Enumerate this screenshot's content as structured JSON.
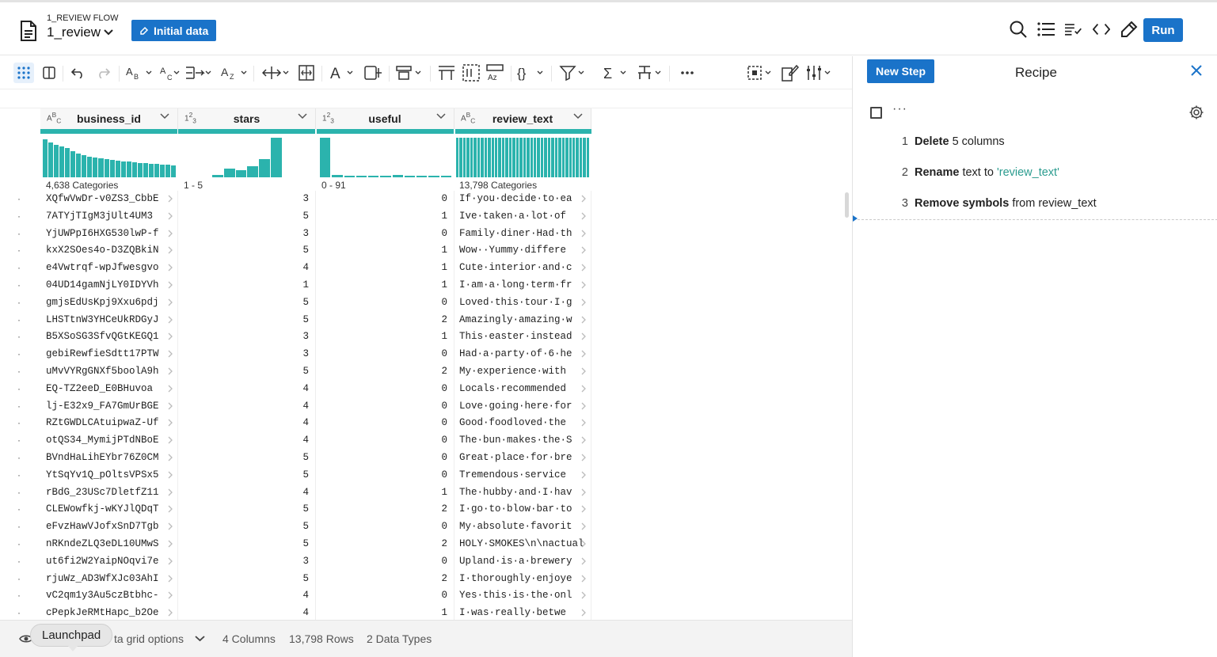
{
  "header": {
    "flow_label": "1_REVIEW FLOW",
    "flow_name": "1_review",
    "initial_data_label": "Initial data",
    "run_label": "Run"
  },
  "icons": {
    "top": [
      "search-icon",
      "list-icon",
      "list-check-icon",
      "code-icon",
      "pipette-icon"
    ],
    "toolbar": [
      "grid-view-icon",
      "columns-view-icon",
      "undo-icon",
      "redo-icon",
      "format-icon",
      "spellcheck-icon",
      "merge-icon",
      "sort-icon",
      "move-icon",
      "split-icon",
      "text-icon",
      "replace-icon",
      "structure-icon",
      "pivot-icon",
      "extract-icon",
      "text-transform-icon",
      "braces-icon",
      "filter-icon",
      "sum-icon",
      "tree-icon",
      "more-icon",
      "select-icon",
      "edit-icon",
      "settings-icon"
    ]
  },
  "columns": [
    {
      "type": "ABC",
      "name": "business_id",
      "summary": "4,638 Categories"
    },
    {
      "type": "123",
      "name": "stars",
      "summary": "1 - 5"
    },
    {
      "type": "123",
      "name": "useful",
      "summary": "0 - 91"
    },
    {
      "type": "ABC",
      "name": "review_text",
      "summary": "13,798 Categories"
    }
  ],
  "histograms": {
    "business_id": [
      0.95,
      0.88,
      0.82,
      0.78,
      0.74,
      0.66,
      0.6,
      0.55,
      0.52,
      0.5,
      0.48,
      0.46,
      0.44,
      0.42,
      0.4,
      0.39,
      0.38,
      0.36,
      0.35,
      0.34,
      0.33,
      0.32,
      0.31,
      0.3
    ],
    "stars": [
      0.06,
      0.22,
      0.18,
      0.28,
      0.45,
      1.0
    ],
    "useful": [
      1.0,
      0.05,
      0.04,
      0.04,
      0.03,
      0.02,
      0.05,
      0.02,
      0.03,
      0.02,
      0.01
    ],
    "review_text_bars": 38
  },
  "rows": [
    [
      "XQfwVwDr-v0ZS3_CbbE",
      "3",
      "0",
      "If·you·decide·to·ea"
    ],
    [
      "7ATYjTIgM3jUlt4UM3",
      "5",
      "1",
      "Ive·taken·a·lot·of"
    ],
    [
      "YjUWPpI6HXG530lwP-f",
      "3",
      "0",
      "Family·diner·Had·th"
    ],
    [
      "kxX2SOes4o-D3ZQBkiN",
      "5",
      "1",
      "Wow··Yummy·differe"
    ],
    [
      "e4Vwtrqf-wpJfwesgvo",
      "4",
      "1",
      "Cute·interior·and·c"
    ],
    [
      "04UD14gamNjLY0IDYVh",
      "1",
      "1",
      "I·am·a·long·term·fr"
    ],
    [
      "gmjsEdUsKpj9Xxu6pdj",
      "5",
      "0",
      "Loved·this·tour·I·g"
    ],
    [
      "LHSTtnW3YHCeUkRDGyJ",
      "5",
      "2",
      "Amazingly·amazing·w"
    ],
    [
      "B5XSoSG3SfvQGtKEGQ1",
      "3",
      "1",
      "This·easter·instead"
    ],
    [
      "gebiRewfieSdtt17PTW",
      "3",
      "0",
      "Had·a·party·of·6·he"
    ],
    [
      "uMvVYRgGNXf5boolA9h",
      "5",
      "2",
      "My·experience·with"
    ],
    [
      "EQ-TZ2eeD_E0BHuvoa",
      "4",
      "0",
      "Locals·recommended"
    ],
    [
      "lj-E32x9_FA7GmUrBGE",
      "4",
      "0",
      "Love·going·here·for"
    ],
    [
      "RZtGWDLCAtuipwaZ-Uf",
      "4",
      "0",
      "Good·foodloved·the"
    ],
    [
      "otQS34_MymijPTdNBoE",
      "4",
      "0",
      "The·bun·makes·the·S"
    ],
    [
      "BVndHaLihEYbr76Z0CM",
      "5",
      "0",
      "Great·place·for·bre"
    ],
    [
      "YtSqYv1Q_pOltsVPSx5",
      "5",
      "0",
      "Tremendous·service"
    ],
    [
      "rBdG_23USc7DletfZ11",
      "4",
      "1",
      "The·hubby·and·I·hav"
    ],
    [
      "CLEWowfkj-wKYJlQDqT",
      "5",
      "2",
      "I·go·to·blow·bar·to"
    ],
    [
      "eFvzHawVJofxSnD7Tgb",
      "5",
      "0",
      "My·absolute·favorit"
    ],
    [
      "nRKndeZLQ3eDL10UMwS",
      "5",
      "2",
      "HOLY·SMOKES\\n\\nactual"
    ],
    [
      "ut6fi2W2YaipNOqvi7e",
      "3",
      "0",
      "Upland·is·a·brewery"
    ],
    [
      "rjuWz_AD3WfXJc03AhI",
      "5",
      "2",
      "I·thoroughly·enjoye"
    ],
    [
      "vC2qm1y3Au5czBtbhc-",
      "4",
      "0",
      "Yes·this·is·the·onl"
    ],
    [
      "cPepkJeRMtHapc_b2Oe",
      "4",
      "1",
      "I·was·really·betwe"
    ]
  ],
  "status": {
    "grid_options": "ta grid options",
    "columns": "4 Columns",
    "rows": "13,798 Rows",
    "types": "2 Data Types",
    "tooltip": "Launchpad"
  },
  "recipe": {
    "new_step": "New Step",
    "title": "Recipe",
    "more": "···",
    "steps": [
      {
        "num": "1",
        "bold": "Delete",
        "rest": "5 columns",
        "quote": ""
      },
      {
        "num": "2",
        "bold": "Rename",
        "rest": "text to",
        "quote": "'review_text'"
      },
      {
        "num": "3",
        "bold": "Remove symbols",
        "rest": "from review_text",
        "quote": ""
      }
    ]
  },
  "colors": {
    "accent": "#1a73c9",
    "teal": "#2bb3ad"
  }
}
